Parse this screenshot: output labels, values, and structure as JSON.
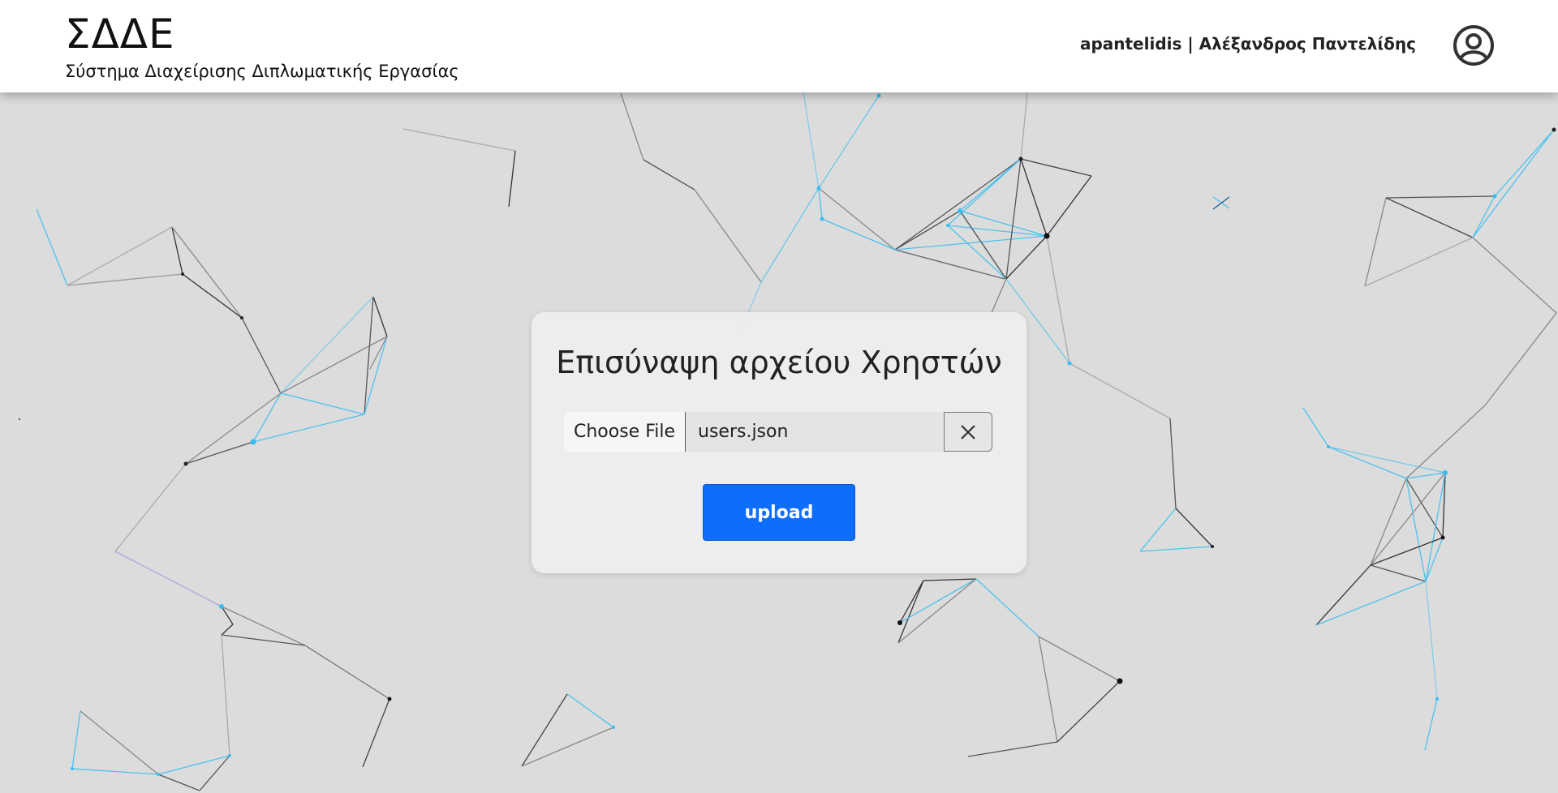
{
  "header": {
    "title": "ΣΔΔΕ",
    "subtitle": "Σύστημα Διαχείρισης Διπλωματικής Εργασίας",
    "user_label": "apantelidis | Αλέξανδρος Παντελίδης",
    "avatar_icon": "user-circle-icon"
  },
  "upload_card": {
    "title": "Επισύναψη αρχείου Χρηστών",
    "choose_file_label": "Choose File",
    "selected_file": "users.json",
    "clear_icon": "close-icon",
    "upload_label": "upload"
  },
  "colors": {
    "background": "#dcdcdc",
    "header_bg": "#ffffff",
    "primary_button": "#0d6efd",
    "network_blue": "#3bbcf0",
    "network_dark": "#222222"
  }
}
